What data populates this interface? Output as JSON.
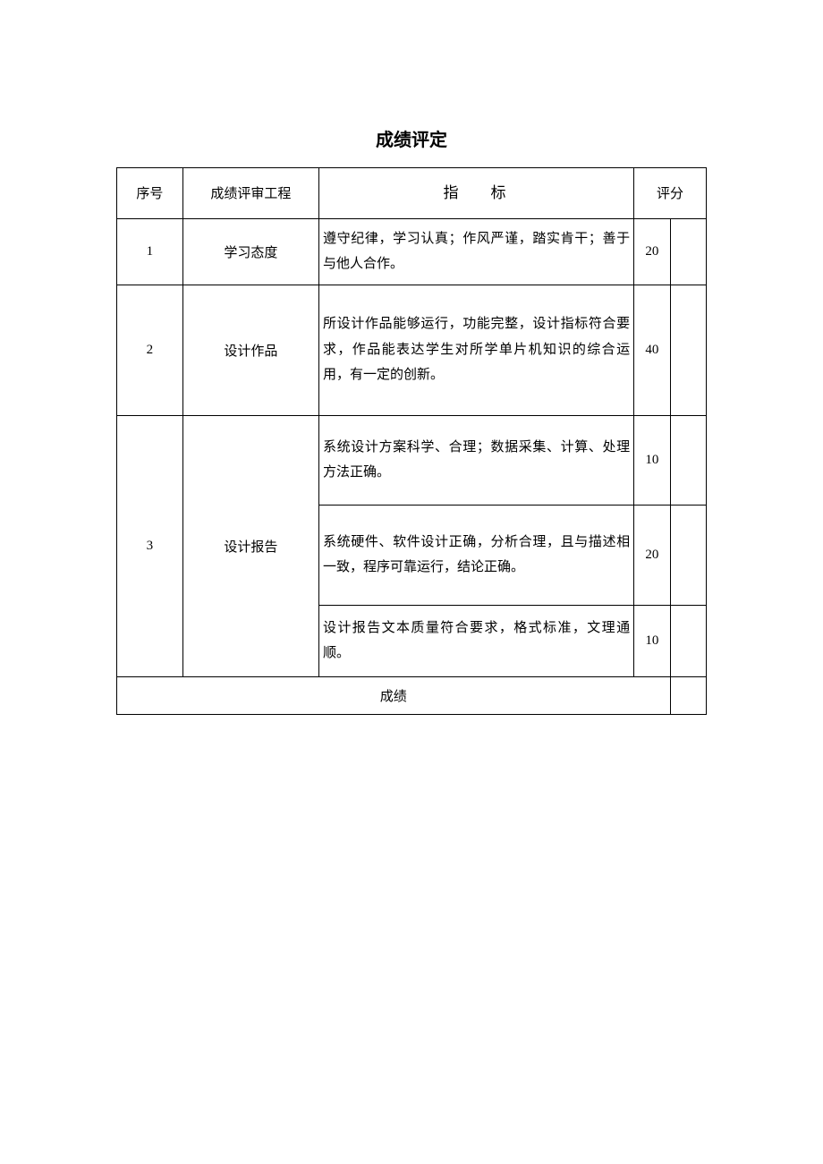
{
  "title": "成绩评定",
  "headers": {
    "seq": "序号",
    "project": "成绩评审工程",
    "indicator": "指标",
    "score": "评分"
  },
  "rows": [
    {
      "seq": "1",
      "project": "学习态度",
      "indicator": "遵守纪律，学习认真；作风严谨，踏实肯干；善于与他人合作。",
      "score": "20"
    },
    {
      "seq": "2",
      "project": "设计作品",
      "indicator": "所设计作品能够运行，功能完整，设计指标符合要求，作品能表达学生对所学单片机知识的综合运用，有一定的创新。",
      "score": "40"
    }
  ],
  "row3": {
    "seq": "3",
    "project": "设计报告",
    "items": [
      {
        "indicator": "系统设计方案科学、合理；数据采集、计算、处理方法正确。",
        "score": "10"
      },
      {
        "indicator": "系统硬件、软件设计正确，分析合理，且与描述相一致，程序可靠运行，结论正确。",
        "score": "20"
      },
      {
        "indicator": "设计报告文本质量符合要求，格式标准，文理通顺。",
        "score": "10"
      }
    ]
  },
  "footer": {
    "label": "成绩"
  }
}
